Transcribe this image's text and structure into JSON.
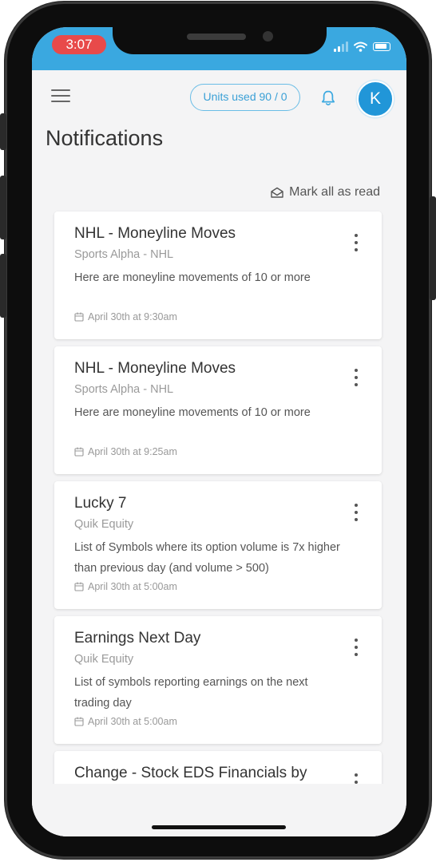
{
  "status_bar": {
    "time": "3:07",
    "colors": {
      "bar": "#3aa8e0",
      "time_pill": "#e84a4a"
    }
  },
  "header": {
    "units_label": "Units used 90 / 0",
    "avatar_initial": "K",
    "accent_color": "#2196d8"
  },
  "page": {
    "title": "Notifications",
    "mark_all_label": "Mark all as read"
  },
  "notifications": [
    {
      "title": "NHL - Moneyline Moves",
      "source": "Sports Alpha - NHL",
      "description": "Here are moneyline movements of 10 or more",
      "date": "April 30th at 9:30am"
    },
    {
      "title": "NHL - Moneyline Moves",
      "source": "Sports Alpha - NHL",
      "description": "Here are moneyline movements of 10 or more",
      "date": "April 30th at 9:25am"
    },
    {
      "title": "Lucky 7",
      "source": "Quik Equity",
      "description": "List of Symbols where its option volume is 7x higher than previous day (and volume > 500)",
      "date": "April 30th at 5:00am"
    },
    {
      "title": "Earnings Next Day",
      "source": "Quik Equity",
      "description": "List of symbols reporting earnings on the next trading day",
      "date": "April 30th at 5:00am"
    },
    {
      "title": "Change - Stock EDS Financials by",
      "source": "",
      "description": "",
      "date": ""
    }
  ],
  "icons": [
    "menu-icon",
    "bell-icon",
    "envelope-open-icon",
    "calendar-icon",
    "more-vertical-icon"
  ]
}
